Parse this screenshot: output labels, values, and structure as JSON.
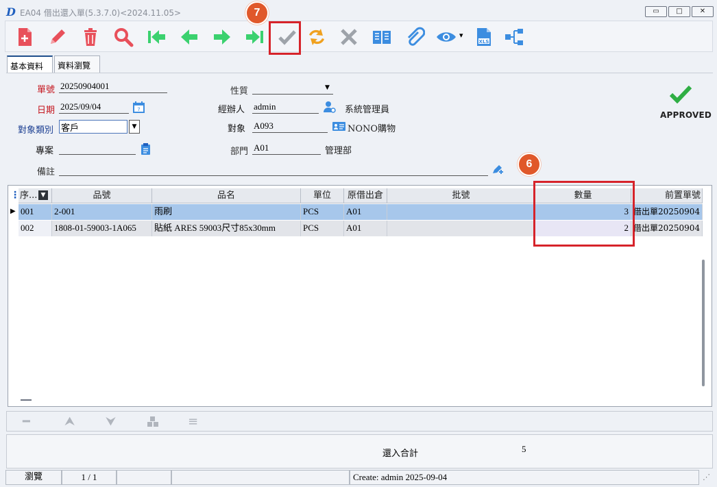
{
  "window": {
    "logo": "D",
    "title": "EA04 借出還入單(5.3.7.0)<2024.11.05>",
    "controls": {
      "minimize": "▭",
      "maximize": "□",
      "close": "✕"
    }
  },
  "toolbar": {
    "buttons": [
      {
        "icon": "new-document-icon",
        "color": "#e8505b"
      },
      {
        "icon": "edit-pencil-icon",
        "color": "#e8505b"
      },
      {
        "icon": "delete-trash-icon",
        "color": "#e8505b"
      },
      {
        "icon": "search-magnifier-icon",
        "color": "#e8505b"
      },
      {
        "icon": "first-record-icon",
        "color": "#3bd16f"
      },
      {
        "icon": "previous-record-icon",
        "color": "#3bd16f"
      },
      {
        "icon": "next-record-icon",
        "color": "#3bd16f"
      },
      {
        "icon": "last-record-icon",
        "color": "#3bd16f"
      },
      {
        "icon": "confirm-check-icon",
        "color": "#9ea3aa"
      },
      {
        "icon": "refresh-icon",
        "color": "#f0a11f"
      },
      {
        "icon": "cancel-x-icon",
        "color": "#9ea3aa"
      },
      {
        "icon": "book-icon",
        "color": "#3c8de0"
      },
      {
        "icon": "attachment-clip-icon",
        "color": "#3c8de0"
      },
      {
        "icon": "view-eye-icon",
        "color": "#3c8de0"
      },
      {
        "icon": "excel-export-icon",
        "color": "#3c8de0"
      },
      {
        "icon": "flowchart-icon",
        "color": "#3c8de0"
      }
    ],
    "xls_label": "XLS",
    "eye_dropdown": "▾"
  },
  "annotations": {
    "step7": "7",
    "step6": "6",
    "highlight_color": "#d6232a",
    "badge_color": "#e0582a"
  },
  "tabs": [
    "基本資料",
    "資料瀏覽"
  ],
  "form": {
    "order_no_label": "單號",
    "order_no": "20250904001",
    "date_label": "日期",
    "date": "2025/09/04",
    "target_type_label": "對象類別",
    "target_type": "客戶",
    "project_label": "專案",
    "project": "",
    "note_label": "備註",
    "note": "",
    "nature_label": "性質",
    "nature": "",
    "handler_label": "經辦人",
    "handler": "admin",
    "handler_name": "系統管理員",
    "target_label": "對象",
    "target": "A093",
    "target_name": "NONO購物",
    "dept_label": "部門",
    "dept": "A01",
    "dept_name": "管理部",
    "status": "APPROVED"
  },
  "grid": {
    "columns": [
      "序...",
      "品號",
      "品名",
      "單位",
      "原借出倉",
      "批號",
      "數量",
      "前置單號"
    ],
    "rows": [
      {
        "seq": "001",
        "item_no": "2-001",
        "item_name": "雨刷",
        "unit": "PCS",
        "warehouse": "A01",
        "batch": "",
        "qty": "3",
        "prev": "借出單20250904"
      },
      {
        "seq": "002",
        "item_no": "1808-01-59003-1A065",
        "item_name": "貼紙  ARES 59003尺寸85x30mm",
        "unit": "PCS",
        "warehouse": "A01",
        "batch": "",
        "qty": "2",
        "prev": "借出單20250904"
      }
    ]
  },
  "nav_icons": [
    "remove-row-icon",
    "move-up-icon",
    "move-down-icon",
    "stack-icon",
    "menu-lines-icon"
  ],
  "summary": {
    "label": "還入合計",
    "value": "5"
  },
  "statusbar": {
    "mode": "瀏覽",
    "page": "1 / 1",
    "created": "Create: admin 2025-09-04"
  }
}
